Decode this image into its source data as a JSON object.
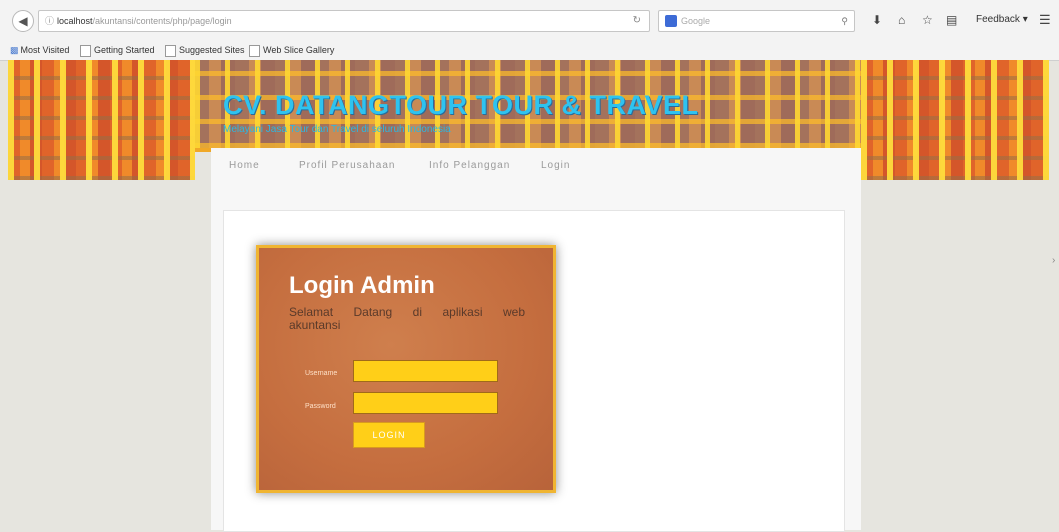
{
  "browser": {
    "url_host": "localhost",
    "url_path": "/akuntansi/contents/php/page/login",
    "search_placeholder": "Google",
    "feedback_label": "Feedback",
    "bookmarks": [
      "Most Visited",
      "Getting Started",
      "Suggested Sites",
      "Web Slice Gallery"
    ]
  },
  "site": {
    "title": "CV. DATANGTOUR TOUR & TRAVEL",
    "subtitle": "Melayani Jasa Tour dan Travel di seluruh Indonesia"
  },
  "nav": {
    "items": [
      "Home",
      "Profil Perusahaan",
      "Info Pelanggan",
      "Login"
    ]
  },
  "login": {
    "title": "Login Admin",
    "welcome_line1": "Selamat Datang di aplikasi web",
    "welcome_line2": "akuntansi",
    "username_label": "Username",
    "password_label": "Password",
    "username_value": "",
    "password_value": "",
    "button_label": "LOGIN"
  },
  "colors": {
    "card": "#c56e3f",
    "input": "#ffcf18",
    "title": "#2ec3f0",
    "banner_accent": "#f0a827"
  }
}
